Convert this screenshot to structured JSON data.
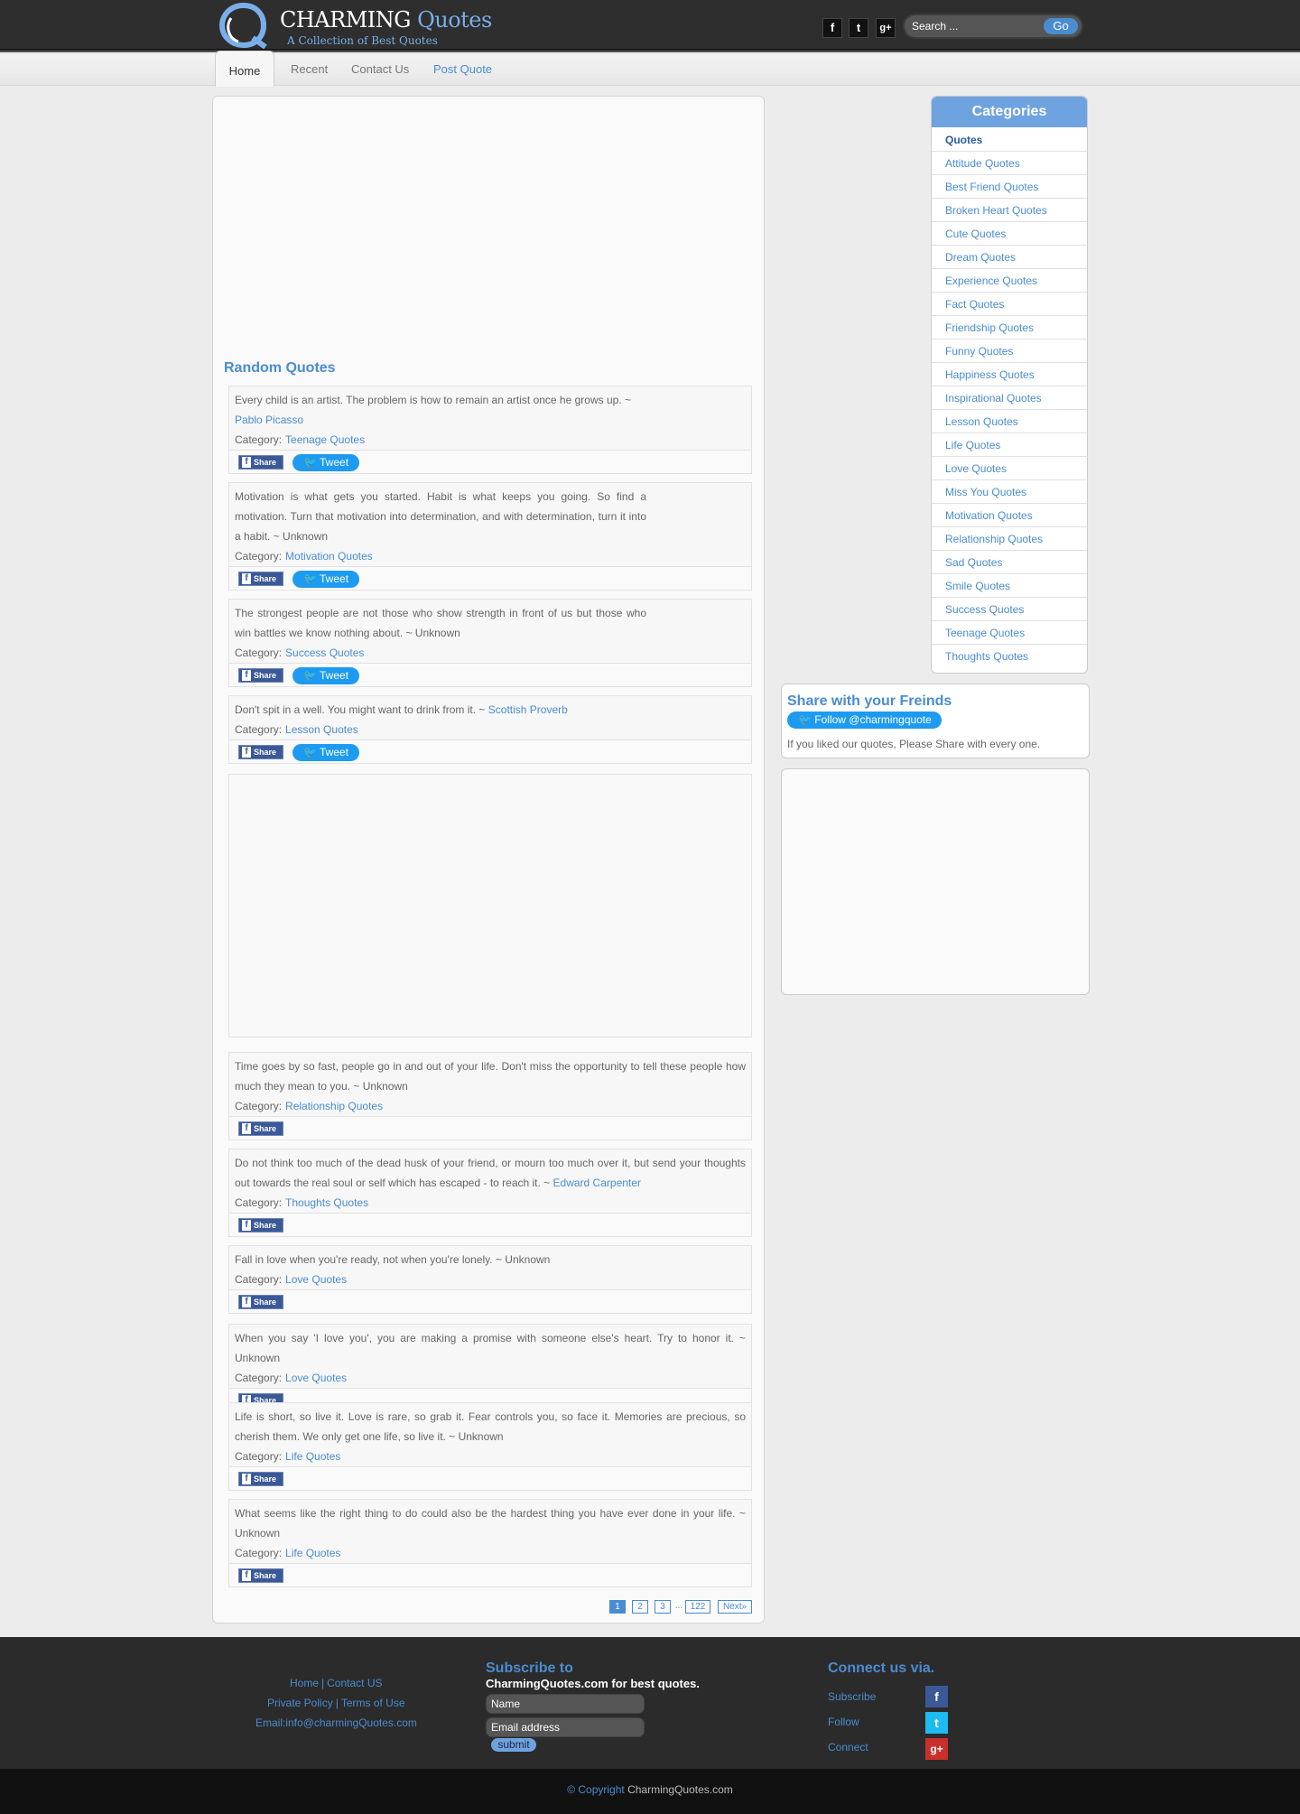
{
  "header": {
    "brand_word1": "CHARMING",
    "brand_word2": "Quotes",
    "tagline": "A Collection of Best Quotes",
    "social": [
      "f",
      "t",
      "g+"
    ],
    "search": {
      "placeholder": "Search ...",
      "button": "Go"
    }
  },
  "nav": {
    "items": [
      "Home",
      "Recent",
      "Contact Us",
      "Post Quote"
    ],
    "active": "Home"
  },
  "main": {
    "section_title": "Random Quotes",
    "category_label": "Category:",
    "share_label": "Share",
    "tweet_label": "Tweet",
    "quotes": [
      {
        "text": "Every child is an artist. The problem is how to remain an artist once he grows up. ~",
        "author": "Pablo Picasso",
        "category": "Teenage Quotes"
      },
      {
        "text": "Motivation is what gets you started. Habit is what keeps you going. So find a motivation. Turn that motivation into determination, and with determination, turn it into a habit. ~ Unknown",
        "category": "Motivation Quotes"
      },
      {
        "text": "The strongest people are not those who show strength in front of us but those who win battles we know nothing about. ~ Unknown",
        "category": "Success Quotes"
      },
      {
        "text": "Don't spit in a well. You might want to drink from it. ~",
        "author": "Scottish Proverb",
        "category": "Lesson Quotes"
      },
      {
        "text": "Time goes by so fast, people go in and out of your life. Don't miss the opportunity to tell these people how much they mean to you. ~ Unknown",
        "category": "Relationship Quotes"
      },
      {
        "text": "Do not think too much of the dead husk of your friend, or mourn too much over it, but send your thoughts out towards the real soul or self which has escaped - to reach it. ~",
        "author": "Edward Carpenter",
        "category": "Thoughts Quotes"
      },
      {
        "text": "Fall in love when you're ready, not when you're lonely. ~ Unknown",
        "category": "Love Quotes"
      },
      {
        "text": "When you say 'I love you', you are making a promise with someone else's heart. Try to honor it. ~ Unknown",
        "category": "Love Quotes"
      },
      {
        "text": "Life is short, so live it. Love is rare, so grab it. Fear controls you, so face it. Memories are precious, so cherish them. We only get one life, so live it. ~ Unknown",
        "category": "Life Quotes"
      },
      {
        "text": "What seems like the right thing to do could also be the hardest thing you have ever done in your life. ~ Unknown",
        "category": "Life Quotes"
      }
    ],
    "pagination": [
      "1",
      "2",
      "3",
      "...",
      "122",
      "Next»"
    ]
  },
  "sidebar": {
    "categories_title": "Categories",
    "categories": [
      "Quotes",
      "Attitude Quotes",
      "Best Friend Quotes",
      "Broken Heart Quotes",
      "Cute Quotes",
      "Dream Quotes",
      "Experience Quotes",
      "Fact Quotes",
      "Friendship Quotes",
      "Funny Quotes",
      "Happiness Quotes",
      "Inspirational Quotes",
      "Lesson Quotes",
      "Life Quotes",
      "Love Quotes",
      "Miss You Quotes",
      "Motivation Quotes",
      "Relationship Quotes",
      "Sad Quotes",
      "Smile Quotes",
      "Success Quotes",
      "Teenage Quotes",
      "Thoughts Quotes"
    ],
    "share": {
      "title": "Share with your Freinds",
      "follow": "Follow @charmingquote",
      "desc": "If you liked our quotes, Please Share with every one."
    }
  },
  "footer": {
    "links1": [
      "Home",
      "Contact US"
    ],
    "links2": [
      "Private Policy",
      "Terms of Use"
    ],
    "email": "Email:info@charmingQuotes.com",
    "subscribe_title": "Subscribe to",
    "subscribe_desc": "CharmingQuotes.com for best quotes.",
    "name_placeholder": "Name",
    "email_placeholder": "Email address",
    "submit": "submit",
    "connect_title": "Connect us via.",
    "connect": [
      "Subscribe",
      "Follow",
      "Connect"
    ],
    "copyright_link": "© Copyright",
    "copyright_site": "CharmingQuotes.com"
  },
  "colors": {
    "accent": "#4a8cd0",
    "header": "#2e2e2e",
    "facebook": "#3b5998",
    "twitter": "#1d9bf0",
    "gplus": "#c9302c"
  }
}
